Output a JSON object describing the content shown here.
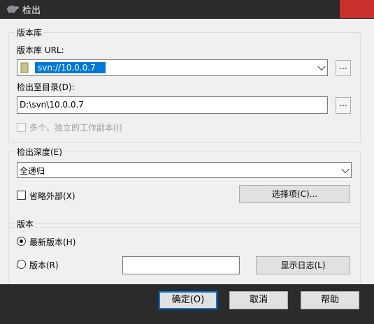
{
  "window": {
    "title": "检出"
  },
  "repository": {
    "group_label": "版本库",
    "url_label": "版本库 URL:",
    "url_value": "svn://10.0.0.7",
    "browse_label": "...",
    "checkout_dir_label": "检出至目录(D):",
    "checkout_dir_value": "D:\\svn\\10.0.0.7",
    "browse_dir_label": "...",
    "multiple_wc_label": "多个、独立的工作副本(I)"
  },
  "depth": {
    "group_label": "检出深度(E)",
    "selected": "全递归",
    "omit_externals_label": "省略外部(X)",
    "choose_items_label": "选择项(C)..."
  },
  "revision": {
    "group_label": "版本",
    "head_label": "最新版本(H)",
    "rev_label": "版本(R)",
    "rev_value": "",
    "show_log_label": "显示日志(L)"
  },
  "buttons": {
    "ok_label": "确定(O)",
    "cancel_label": "取消",
    "help_label": "帮助"
  },
  "colors": {
    "titlebar": "#2b2b2b",
    "close": "#c8312b",
    "dialog_bg": "#f0f0f0",
    "selection": "#0078d7"
  },
  "icons": {
    "title": "tortoise-icon",
    "url_folder": "folder-icon"
  }
}
